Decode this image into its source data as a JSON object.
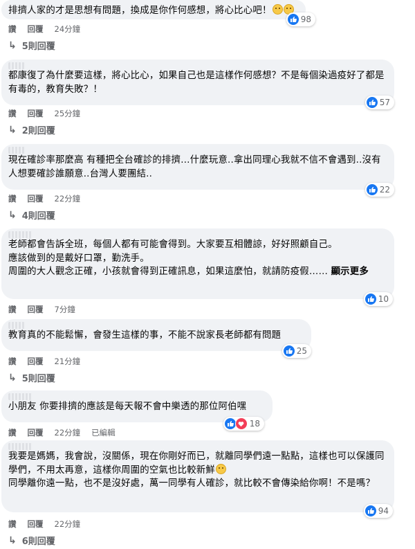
{
  "comments": [
    {
      "text": "排擠人家的才是思想有問題，換成是你作何感想，將心比心吧！",
      "reactions": "98",
      "actions": [
        "讚",
        "回覆"
      ],
      "time": "24分鐘",
      "replies": "5則回覆"
    },
    {
      "text": "都康復了為什麼要這樣，將心比心，如果自己也是這樣作何感想？不是每個染過疫好了都是有毒的，教育失敗？！",
      "reactions": "57",
      "actions": [
        "讚",
        "回覆"
      ],
      "time": "25分鐘",
      "replies": "2則回覆"
    },
    {
      "text": "現在確診率那麼高 有種把全台確診的排擠…什麼玩意..拿出同理心我就不信不會遇到..沒有人想要確診誰願意..台灣人要團結..",
      "reactions": "22",
      "actions": [
        "讚",
        "回覆"
      ],
      "time": "22分鐘",
      "replies": "4則回覆"
    },
    {
      "text": "老師都會告訴全班，每個人都有可能會得到。大家要互相體諒，好好照顧自己。\n應該做到的是戴好口罩，勤洗手。\n周圍的大人觀念正確，小孩就會得到正確訊息，如果這麼怕，就請防疫假……",
      "more": "顯示更多",
      "reactions": "10",
      "actions": [
        "讚",
        "回覆"
      ],
      "time": "7分鐘"
    },
    {
      "text": "教育真的不能鬆懈，會發生這樣的事，不能不說家長老師都有問題",
      "reactions": "25",
      "actions": [
        "讚",
        "回覆"
      ],
      "time": "21分鐘",
      "replies": "5則回覆"
    },
    {
      "text": "小朋友 你要排擠的應該是每天報不會中樂透的那位阿伯嘿",
      "reactions": "18",
      "actions": [
        "讚",
        "回覆"
      ],
      "time": "22分鐘",
      "edited": "已編輯"
    },
    {
      "text": "我要是媽媽，我會說，沒關係，現在你剛好而已，就離同學們遠一點點，這樣也可以保護同學們，不用太再意，這樣你周圍的空氣也比較新鮮",
      "text2": "同學離你遠一點，也不是沒好處，萬一同學有人確診，就比較不會傳染給你啊！不是嗎？",
      "reactions": "94",
      "actions": [
        "讚",
        "回覆"
      ],
      "time": "22分鐘",
      "replies": "6則回覆"
    }
  ],
  "colors": {
    "like": "#1877f2",
    "love": "#f33e58",
    "bubble": "#f0f2f5",
    "meta": "#65676b"
  }
}
